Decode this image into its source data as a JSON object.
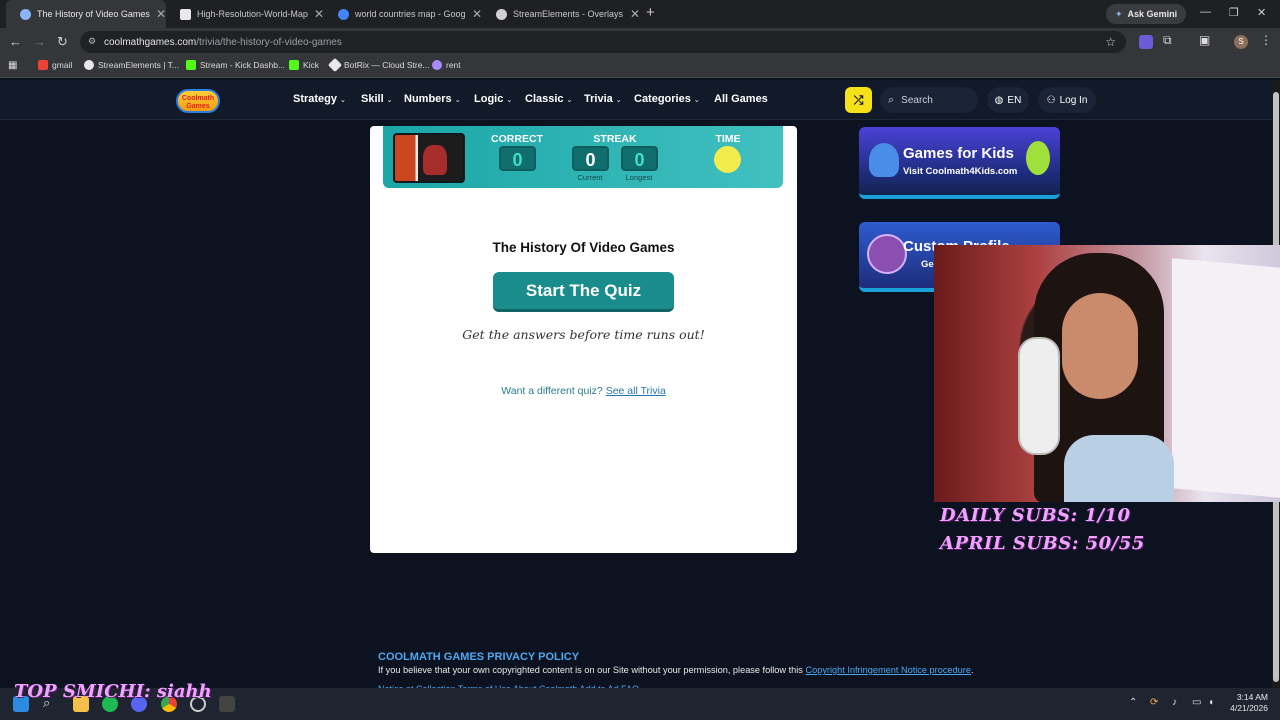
{
  "tabs": [
    {
      "title": "The History of Video Games | F",
      "active": true,
      "color": "#8ab4f8"
    },
    {
      "title": "High-Resolution-World-Map.jp",
      "active": false,
      "color": "#e9e9e9"
    },
    {
      "title": "world countries map - Google",
      "active": false,
      "color": "#4285f4"
    },
    {
      "title": "StreamElements - Overlays",
      "active": false,
      "color": "#d0d0d0"
    }
  ],
  "browser": {
    "new_tab": "+",
    "ask_gemini": "Ask Gemini",
    "url_host": "coolmathgames.com",
    "url_path": "/trivia/the-history-of-video-games",
    "profile_initial": "S"
  },
  "bookmarks": [
    {
      "label": "gmail",
      "color": "#ea4335"
    },
    {
      "label": "StreamElements | T...",
      "color": "#e8e8e8"
    },
    {
      "label": "Stream - Kick Dashb...",
      "color": "#53fc18"
    },
    {
      "label": "Kick",
      "color": "#53fc18"
    },
    {
      "label": "BotRix — Cloud Stre...",
      "color": "#e8e8e8"
    },
    {
      "label": "rent",
      "color": "#a98bff"
    }
  ],
  "site": {
    "logo_line1": "Coolmath",
    "logo_line2": "Games",
    "nav": [
      "Strategy",
      "Skill",
      "Numbers",
      "Logic",
      "Classic",
      "Trivia",
      "Categories",
      "All Games"
    ],
    "search_placeholder": "Search",
    "language": "EN",
    "login": "Log In"
  },
  "quiz": {
    "correct_label": "CORRECT",
    "correct_value": "0",
    "streak_label": "STREAK",
    "streak_current": "0",
    "streak_longest": "0",
    "current_label": "Current",
    "longest_label": "Longest",
    "time_label": "TIME",
    "title": "The History Of Video Games",
    "start_button": "Start The Quiz",
    "hint": "Get the answers before time runs out!",
    "different_prefix": "Want a different quiz?",
    "different_link": "See all Trivia"
  },
  "promos": {
    "kids_title": "Games for Kids",
    "kids_sub": "Visit Coolmath4Kids.com",
    "profile_title": "Custom Profile",
    "profile_sub": "Ge"
  },
  "overlay": {
    "daily_subs": "DAILY SUBS: 1/10",
    "april_subs": "APRIL SUBS: 50/55",
    "top_smichi": "TOP SMICHI: siahh"
  },
  "footer": {
    "privacy_title": "COOLMATH GAMES PRIVACY POLICY",
    "copyright_text": "If you believe that your own copyrighted content is on our Site without your permission, please follow this",
    "copyright_link": "Copyright Infringement Notice procedure",
    "copyright_end": ".",
    "links_partial": "Notice at Collection    Terms of Use    About Coolmath    Add to Ad    FAQ"
  },
  "taskbar": {
    "time": "3:14 AM",
    "date": "4/21/2026"
  }
}
